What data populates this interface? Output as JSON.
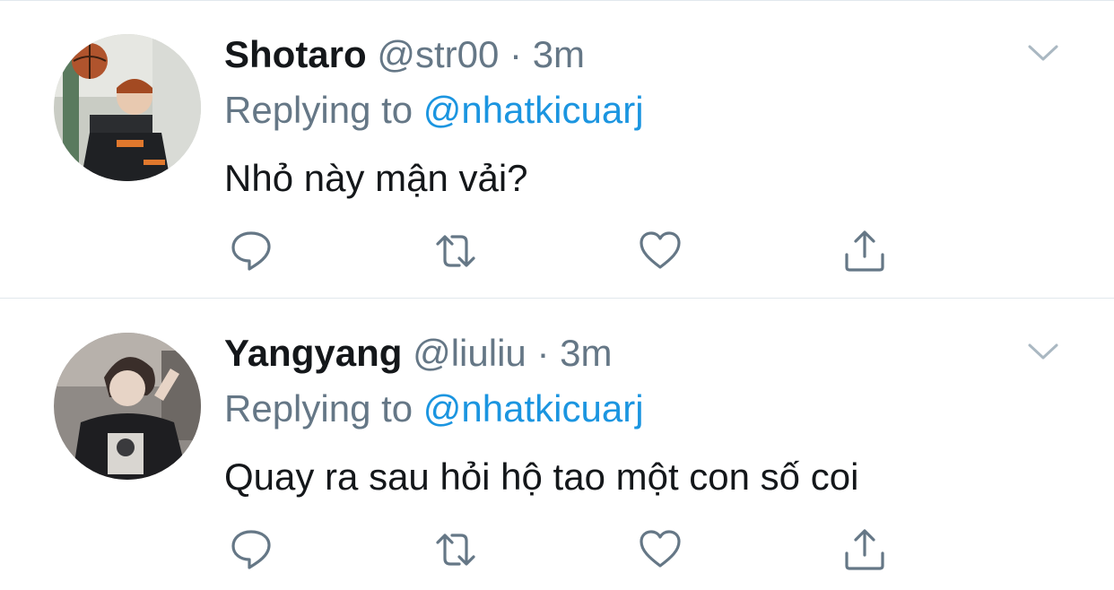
{
  "tweets": [
    {
      "name": "Shotaro",
      "handle": "@str00",
      "separator": "·",
      "time": "3m",
      "replying_label": "Replying to",
      "replying_to": "@nhatkicuarj",
      "text": "Nhỏ này mận vải?",
      "avatar": "avatar-photo-basketball",
      "icons": [
        "chevron-down-icon",
        "reply-icon",
        "retweet-icon",
        "like-icon",
        "share-icon"
      ]
    },
    {
      "name": "Yangyang",
      "handle": "@liuliu",
      "separator": "·",
      "time": "3m",
      "replying_label": "Replying to",
      "replying_to": "@nhatkicuarj",
      "text": "Quay ra sau hỏi hộ tao một con số coi",
      "avatar": "avatar-photo-sweater",
      "icons": [
        "chevron-down-icon",
        "reply-icon",
        "retweet-icon",
        "like-icon",
        "share-icon"
      ]
    }
  ],
  "colors": {
    "name": "#14171a",
    "secondary": "#657786",
    "link": "#1b95e0",
    "icon": "#657786",
    "divider": "#e1e8ed",
    "chevron": "#aab8c2"
  }
}
